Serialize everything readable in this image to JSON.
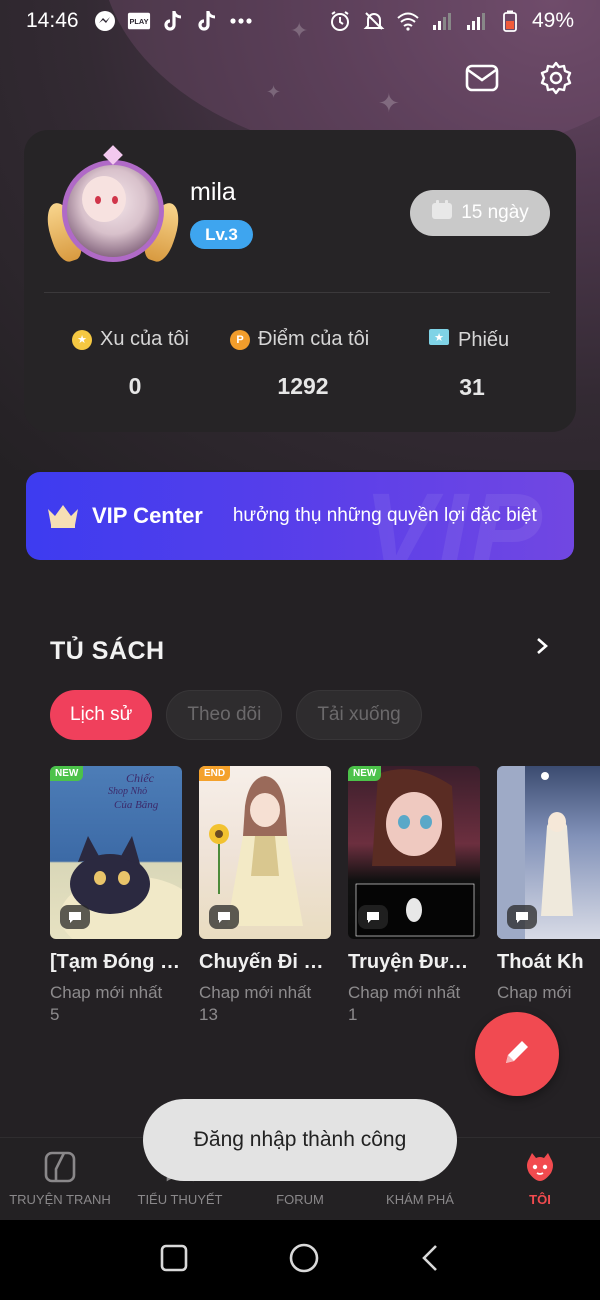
{
  "status_bar": {
    "time": "14:46",
    "battery": "49%",
    "icons_left": [
      "messenger-icon",
      "play-together-icon",
      "tiktok-icon",
      "tiktok-icon",
      "more-dots-icon"
    ],
    "icons_right": [
      "alarm-icon",
      "mute-icon",
      "wifi-icon",
      "signal-icon",
      "signal-icon",
      "battery-icon"
    ]
  },
  "header": {
    "actions": [
      "mail-icon",
      "settings-icon"
    ]
  },
  "profile": {
    "username": "mila",
    "level": "Lv.3",
    "checkin_days": "15 ngày",
    "stats": [
      {
        "label": "Xu của tôi",
        "value": "0",
        "icon": "coin-icon",
        "color": "#f5c842"
      },
      {
        "label": "Điểm của tôi",
        "value": "1292",
        "icon": "points-icon",
        "color": "#f29d2b"
      },
      {
        "label": "Phiếu",
        "value": "31",
        "icon": "ticket-icon",
        "color": "#7fd3e6"
      }
    ]
  },
  "vip": {
    "title": "VIP Center",
    "description": "hưởng thụ những quyền lợi đặc biệt",
    "watermark": "VIP"
  },
  "bookshelf": {
    "title": "TỦ SÁCH",
    "filters": [
      {
        "label": "Lịch sử",
        "active": true
      },
      {
        "label": "Theo dõi",
        "active": false
      },
      {
        "label": "Tải xuống",
        "active": false
      }
    ],
    "books": [
      {
        "tag": "NEW",
        "title": "[Tạm Đóng C...",
        "subtitle": "Chap mới nhất",
        "chapter": "5",
        "cover_text": "Chiếc Shop Nhỏ Của Băng"
      },
      {
        "tag": "END",
        "title": "Chuyến Đi R...",
        "subtitle": "Chap mới nhất",
        "chapter": "13",
        "cover_text": ""
      },
      {
        "tag": "NEW",
        "title": "Truyện Được...",
        "subtitle": "Chap mới nhất",
        "chapter": "1",
        "cover_text": ""
      },
      {
        "tag": "",
        "title": "Thoát Kh",
        "subtitle": "Chap mới",
        "chapter": "",
        "cover_text": ""
      }
    ]
  },
  "toast": "Đăng nhập thành công",
  "bottom_nav": [
    {
      "label": "TRUYỆN TRANH",
      "icon": "comic-icon",
      "active": false
    },
    {
      "label": "TIỂU THUYẾT",
      "icon": "novel-icon",
      "active": false
    },
    {
      "label": "FORUM",
      "icon": "forum-icon",
      "active": false
    },
    {
      "label": "KHÁM PHÁ",
      "icon": "explore-icon",
      "active": false
    },
    {
      "label": "TÔI",
      "icon": "me-icon",
      "active": true
    }
  ],
  "colors": {
    "accent": "#f0405c",
    "vip_start": "#3d3cf0",
    "vip_end": "#7147e2",
    "level_badge": "#3ea5ef",
    "background": "#242124"
  }
}
